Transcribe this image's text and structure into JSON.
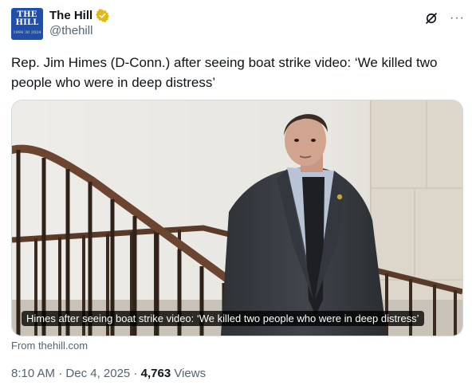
{
  "author": {
    "display_name": "The Hill",
    "handle": "@thehill",
    "avatar_line1": "THE",
    "avatar_line2": "HILL",
    "avatar_line3": "1994 30 2024",
    "verified_icon": "verified-badge-icon",
    "verified_color": "#e2b719"
  },
  "header_actions": {
    "grok_icon": "grok-icon",
    "more_label": "···"
  },
  "tweet": {
    "text": "Rep. Jim Himes (D-Conn.) after seeing boat strike video: ‘We killed two people who were in deep distress’"
  },
  "card": {
    "caption": "Himes after seeing boat strike video: ‘We killed two people who were in deep distress’",
    "source": "From thehill.com"
  },
  "meta": {
    "time": "8:10 AM",
    "sep1": " · ",
    "date": "Dec 4, 2025",
    "sep2": " · ",
    "views_count": "4,763",
    "views_label": " Views"
  },
  "colors": {
    "avatar_bg": "#1f4fa8",
    "text": "#0f1419",
    "muted": "#536471",
    "border": "#cfd9de"
  }
}
